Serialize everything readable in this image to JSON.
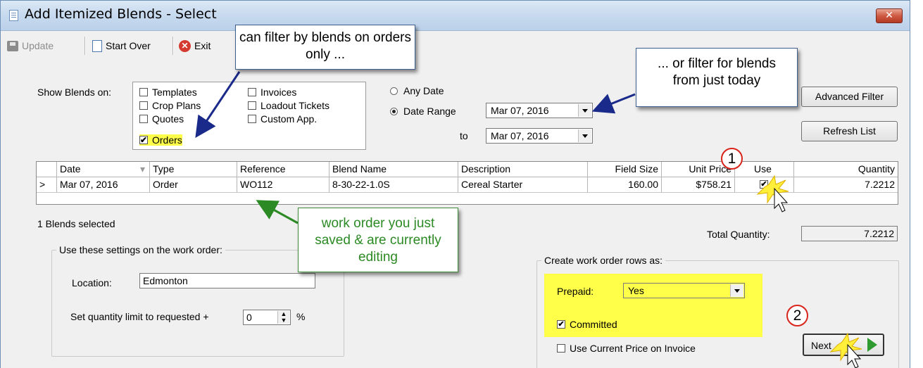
{
  "window": {
    "title": "Add Itemized Blends - Select",
    "close_label": "✕"
  },
  "toolbar": {
    "update_label": "Update",
    "start_over_label": "Start Over",
    "exit_label": "Exit"
  },
  "filter": {
    "show_blends_label": "Show Blends on:",
    "checkboxes": [
      {
        "label": "Templates",
        "checked": false
      },
      {
        "label": "Crop Plans",
        "checked": false
      },
      {
        "label": "Quotes",
        "checked": false
      },
      {
        "label": "Orders",
        "checked": true
      },
      {
        "label": "Invoices",
        "checked": false
      },
      {
        "label": "Loadout Tickets",
        "checked": false
      },
      {
        "label": "Custom App.",
        "checked": false
      }
    ],
    "any_date_label": "Any Date",
    "date_range_label": "Date Range",
    "to_label": "to",
    "date_from": "Mar 07, 2016",
    "date_to": "Mar 07, 2016",
    "advanced_filter_label": "Advanced Filter",
    "refresh_label": "Refresh List"
  },
  "grid": {
    "headers": [
      "Date",
      "Type",
      "Reference",
      "Blend Name",
      "Description",
      "Field Size",
      "Unit Price",
      "Use",
      "Quantity"
    ],
    "row_indicator": ">",
    "rows": [
      {
        "date": "Mar 07, 2016",
        "type": "Order",
        "reference": "WO112",
        "blend_name": "8-30-22-1.0S",
        "description": "Cereal Starter",
        "field_size": "160.00",
        "unit_price": "$758.21",
        "use": true,
        "quantity": "7.2212"
      }
    ]
  },
  "summary": {
    "selected_text": "1 Blends selected",
    "total_quantity_label": "Total Quantity:",
    "total_quantity": "7.2212"
  },
  "settings": {
    "group_label": "Use these settings on the work order:",
    "location_label": "Location:",
    "location_value": "Edmonton",
    "qty_limit_label": "Set quantity limit to requested +",
    "qty_limit_value": "0",
    "percent_label": "%"
  },
  "create_rows": {
    "group_label": "Create work order rows as:",
    "prepaid_label": "Prepaid:",
    "prepaid_value": "Yes",
    "committed_label": "Committed",
    "committed_checked": true,
    "use_current_price_label": "Use Current Price on Invoice",
    "use_current_price_checked": false,
    "next_label": "Next"
  },
  "annotations": {
    "callout_orders": "can filter by blends on orders only ...",
    "callout_today": "... or filter for blends from just today",
    "callout_work_order": "work order you just saved & are currently editing",
    "badge_1": "1",
    "badge_2": "2",
    "callout_color": "#2c8a24",
    "highlight_color": "#ffff4a"
  }
}
